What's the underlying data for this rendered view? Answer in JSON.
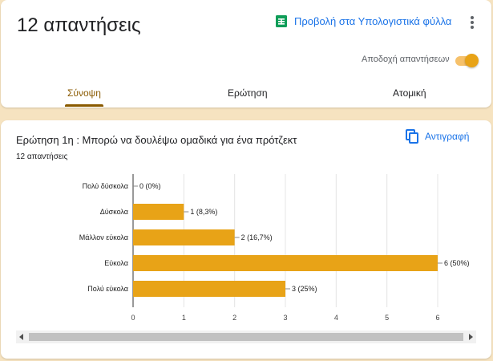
{
  "header": {
    "responses_title": "12 απαντήσεις",
    "sheets_link": "Προβολή στα Υπολογιστικά φύλλα",
    "accepting_label": "Αποδοχή απαντήσεων",
    "accepting": true
  },
  "tabs": [
    {
      "label": "Σύνοψη",
      "active": true
    },
    {
      "label": "Ερώτηση",
      "active": false
    },
    {
      "label": "Ατομική",
      "active": false
    }
  ],
  "question": {
    "title": "Ερώτηση 1η : Μπορώ να δουλέψω ομαδικά για ένα πρότζεκτ",
    "count": "12 απαντήσεις",
    "copy_label": "Αντιγραφή"
  },
  "colors": {
    "accent": "#e8a317",
    "bar": "#e8a317",
    "link": "#1a73e8",
    "tab_active": "#8a5a00",
    "background": "#f6e3c0"
  },
  "icons": {
    "sheets": "sheets-icon",
    "more": "more-vert-icon",
    "copy": "copy-icon"
  },
  "chart_data": {
    "type": "bar",
    "orientation": "horizontal",
    "categories": [
      "Πολύ δύσκολα",
      "Δύσκολα",
      "Μάλλον εύκολα",
      "Εύκολα",
      "Πολύ εύκολα"
    ],
    "values": [
      0,
      1,
      2,
      6,
      3
    ],
    "labels": [
      "0 (0%)",
      "1 (8,3%)",
      "2 (16,7%)",
      "6 (50%)",
      "3 (25%)"
    ],
    "xticks": [
      "0",
      "1",
      "2",
      "3",
      "4",
      "5",
      "6"
    ],
    "xlim": [
      0,
      6
    ],
    "grid": true
  }
}
